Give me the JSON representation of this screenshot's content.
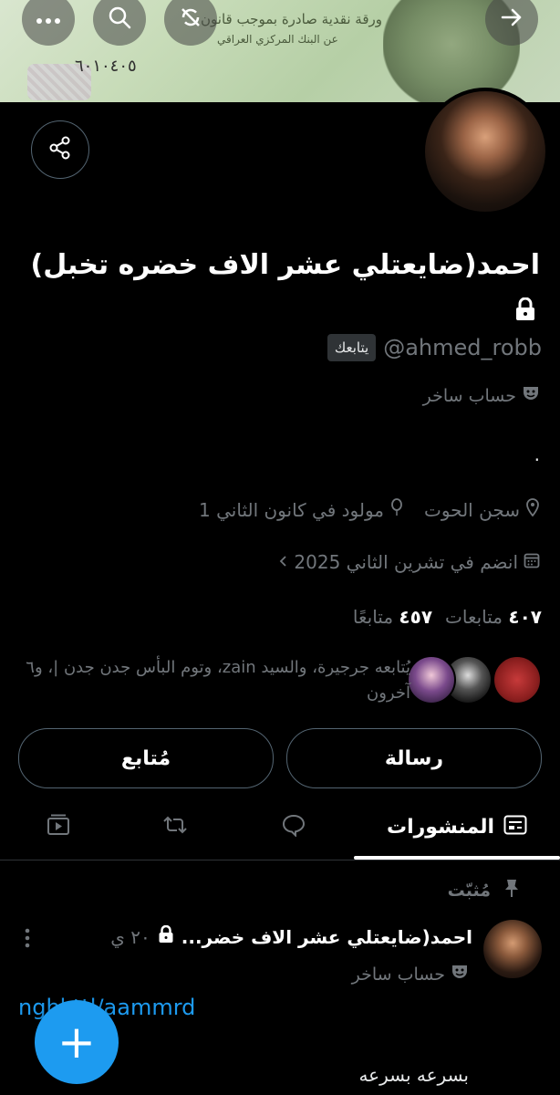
{
  "header": {
    "banner_text_1": "ورقة نقدية صادرة بموجب قانون",
    "banner_text_2": "عن البنك المركزي العراقي",
    "banner_serial": "٦٠١٠٤٠٥"
  },
  "profile": {
    "display_name": "احمد(ضايعتلي عشر الاف خضره تخبل)",
    "handle": "@ahmed_robb",
    "follows_you_label": "يتابعك",
    "parody_label": "حساب ساخر",
    "bio": ".",
    "location": "سجن الحوت",
    "birthday": "مولود في كانون الثاني 1",
    "joined": "انضم في تشرين الثاني 2025",
    "following_count": "٤٠٧",
    "following_label": "متابعات",
    "followers_count": "٤٥٧",
    "followers_label": "متابعًا",
    "followed_by_text": "يُتابعه جرجيرة، والسيد zain، وتوم البأس جدن جدن |، و٦ آخرون"
  },
  "actions": {
    "message_label": "رسالة",
    "following_label": "مُتابع"
  },
  "tabs": {
    "posts_label": "المنشورات"
  },
  "post": {
    "pinned_label": "مُثبّت",
    "author_name": "احمد(ضايعتلي عشر الاف خضر...",
    "time": "٢٠ ي",
    "parody_label": "حساب ساخر",
    "link_text": "nghl.ttl/aammrd",
    "text": "بسرعه بسرعه"
  },
  "fab": {
    "label": "+"
  },
  "colors": {
    "accent": "#1d9bf0",
    "background": "#000000",
    "muted": "#71767b"
  }
}
